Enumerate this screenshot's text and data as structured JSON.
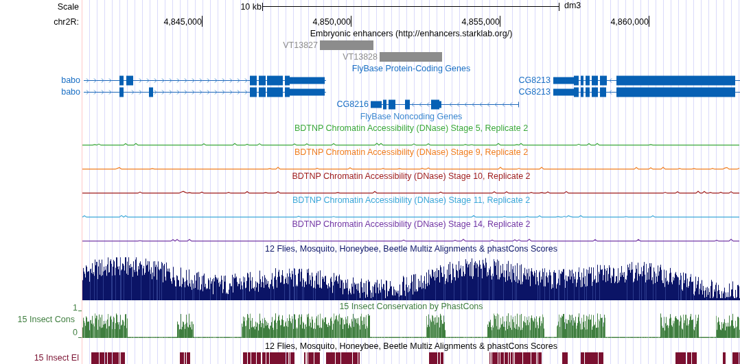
{
  "scale": {
    "label": "Scale",
    "span": "10 kb",
    "assembly": "dm3"
  },
  "position": {
    "label": "chr2R:",
    "ticks": [
      "4,845,000",
      "4,850,000",
      "4,855,000",
      "4,860,000"
    ]
  },
  "enhancers": {
    "title": "Embryonic enhancers (http://enhancers.starklab.org/)",
    "items": [
      {
        "name": "VT13827"
      },
      {
        "name": "VT13828"
      }
    ]
  },
  "coding_genes": {
    "title": "FlyBase Protein-Coding Genes",
    "genes": [
      {
        "name": "babo"
      },
      {
        "name": "babo"
      },
      {
        "name": "CG8213"
      },
      {
        "name": "CG8213"
      },
      {
        "name": "CG8216"
      }
    ]
  },
  "noncoding_genes": {
    "title": "FlyBase Noncoding Genes"
  },
  "dnase_tracks": [
    {
      "title": "BDTNP Chromatin Accessibility (DNase) Stage 5, Replicate 2",
      "color": "#3aa83a"
    },
    {
      "title": "BDTNP Chromatin Accessibility (DNase) Stage 9, Replicate 2",
      "color": "#f07d1e"
    },
    {
      "title": "BDTNP Chromatin Accessibility (DNase) Stage 10, Replicate 2",
      "color": "#9e1a1a"
    },
    {
      "title": "BDTNP Chromatin Accessibility (DNase) Stage 11, Replicate 2",
      "color": "#3ca8d8"
    },
    {
      "title": "BDTNP Chromatin Accessibility (DNase) Stage 14, Replicate 2",
      "color": "#7438a4"
    }
  ],
  "multiz": {
    "title": "12 Flies, Mosquito, Honeybee, Beetle Multiz Alignments & phastCons Scores"
  },
  "phastcons": {
    "label": "15 Insect Cons",
    "title": "15 Insect Conservation by PhastCons",
    "y_max": "1",
    "y_min": "0"
  },
  "elements": {
    "label": "15 Insect El",
    "title": "12 Flies, Mosquito, Honeybee, Beetle Multiz Alignments & phastCons Scores"
  }
}
